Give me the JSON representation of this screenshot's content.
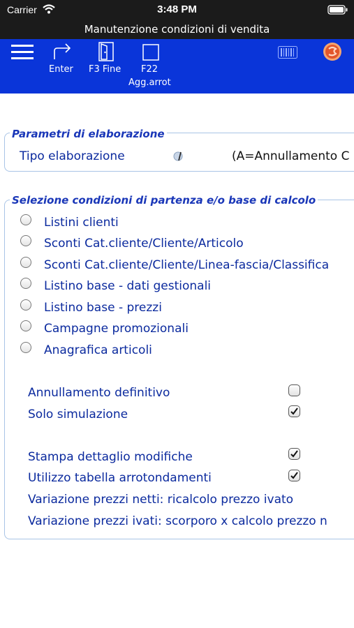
{
  "status_bar": {
    "carrier": "Carrier",
    "time": "3:48 PM"
  },
  "window": {
    "title": "Manutenzione condizioni di vendita"
  },
  "toolbar": {
    "enter_label": "Enter",
    "f3_label": "F3 Fine",
    "f22_label_line1": "F22",
    "f22_label_line2": "Agg.arrot"
  },
  "params": {
    "title": "Parametri di elaborazione",
    "tipo_label": "Tipo elaborazione",
    "tipo_value": "(A=Annullamento C"
  },
  "selection": {
    "title": "Selezione condizioni di partenza e/o base di calcolo",
    "options": [
      "Listini clienti",
      "Sconti Cat.cliente/Cliente/Articolo",
      "Sconti Cat.cliente/Cliente/Linea-fascia/Classifica",
      "Listino base - dati gestionali",
      "Listino base - prezzi",
      "Campagne promozionali",
      "Anagrafica articoli"
    ],
    "annullamento_label": "Annullamento definitivo",
    "annullamento_checked": false,
    "simulazione_label": "Solo simulazione",
    "simulazione_checked": true,
    "stampa_label": "Stampa dettaglio modifiche",
    "stampa_checked": true,
    "tabella_label": "Utilizzo tabella arrotondamenti",
    "tabella_checked": true,
    "var_netti_label": "Variazione prezzi netti: ricalcolo prezzo ivato",
    "var_ivati_label": "Variazione prezzi ivati: scorporo x calcolo prezzo n"
  },
  "colors": {
    "toolbar_bg": "#0a35d9",
    "label_blue": "#0b2a9e",
    "group_border": "#a9c4e6"
  }
}
